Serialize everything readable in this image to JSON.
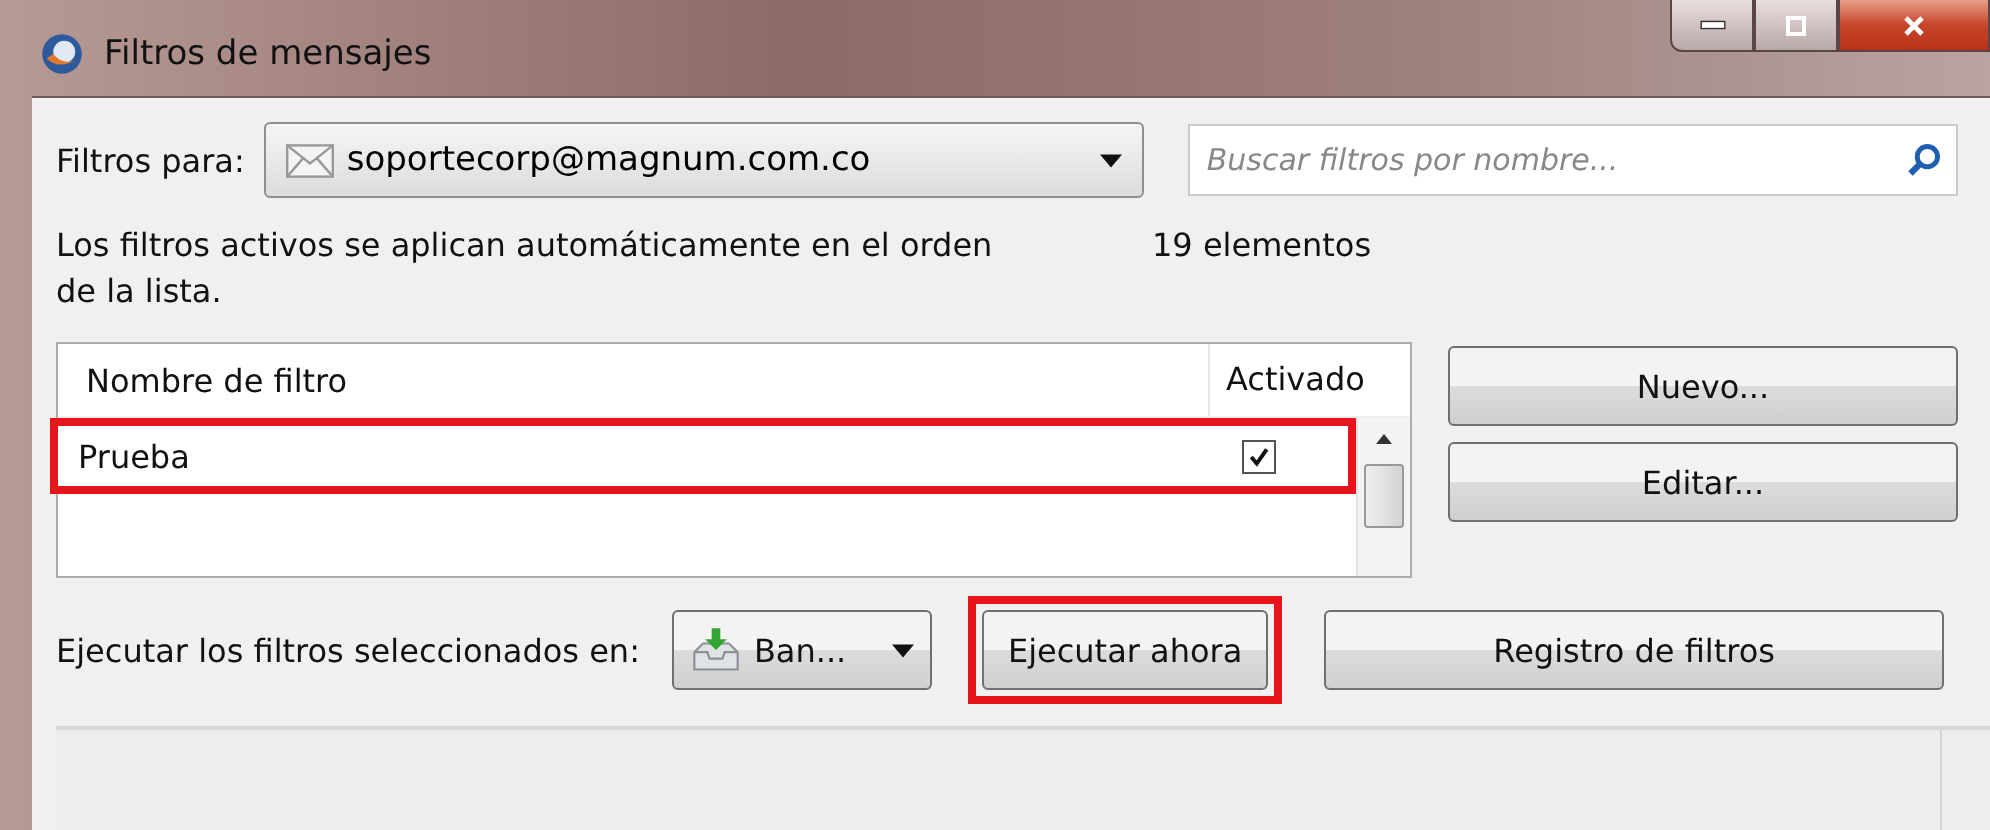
{
  "window": {
    "title": "Filtros de mensajes",
    "controls": [
      {
        "kind": "minimize"
      },
      {
        "kind": "maximize"
      },
      {
        "kind": "close"
      }
    ]
  },
  "filter_for": {
    "label": "Filtros para:",
    "account": "soportecorp@magnum.com.co"
  },
  "search": {
    "placeholder": "Buscar filtros por nombre..."
  },
  "description": "Los filtros activos se aplican automáticamente en el orden de la lista.",
  "count": "19 elementos",
  "table": {
    "columns": [
      "Nombre de filtro",
      "Activado"
    ],
    "rows": [
      {
        "name": "Prueba",
        "checked": true,
        "selected": false,
        "highlighted": true
      }
    ]
  },
  "side_buttons": [
    {
      "label": "Nuevo..."
    },
    {
      "label": "Editar..."
    }
  ],
  "run": {
    "label": "Ejecutar los filtros seleccionados en:",
    "folder": "Ban..."
  },
  "bottom_buttons": [
    {
      "label": "Ejecutar ahora",
      "highlighted": true
    },
    {
      "label": "Registro de filtros",
      "highlighted": false
    }
  ]
}
